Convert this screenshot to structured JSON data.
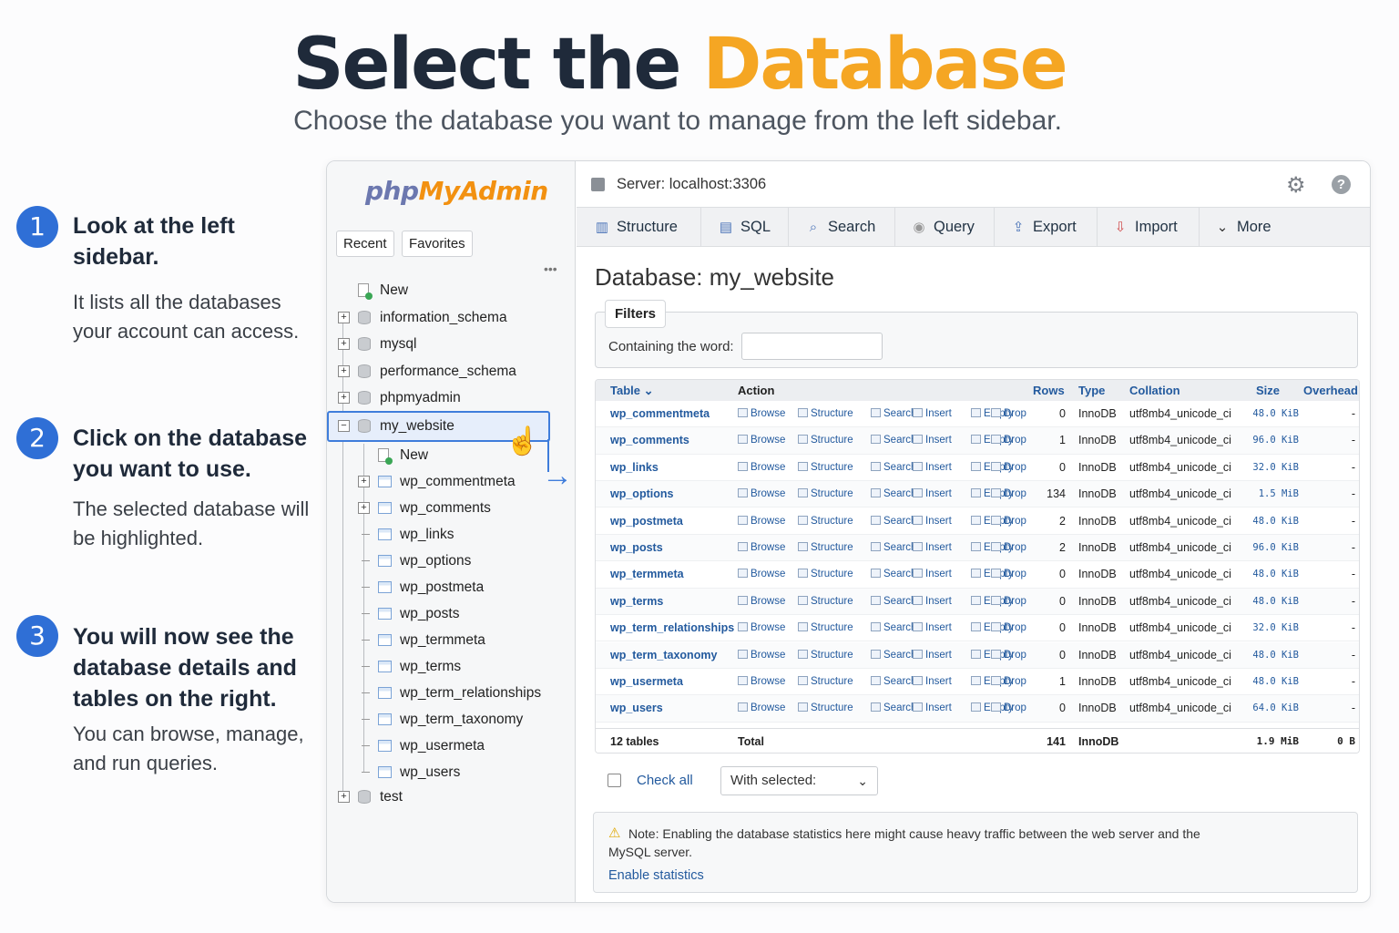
{
  "hero": {
    "title_main": "Select the ",
    "title_accent": "Database",
    "subtitle": "Choose the database you want to manage from the left sidebar.",
    "accent_color": "#f5a623"
  },
  "steps": [
    {
      "num": "1",
      "title": "Look at the left sidebar.",
      "desc": "It lists all the databases your account can access."
    },
    {
      "num": "2",
      "title": "Click on the database you want to use.",
      "desc": "The selected database will be highlighted."
    },
    {
      "num": "3",
      "title": "You will now see the database details and tables on the right.",
      "desc": "You can browse, manage, and run queries."
    }
  ],
  "sidebar": {
    "logo_php": "php",
    "logo_mya": "MyAdmin",
    "recent": "Recent",
    "favorites": "Favorites",
    "dots": "•••",
    "top_new": "New",
    "databases": [
      "information_schema",
      "mysql",
      "performance_schema",
      "phpmyadmin"
    ],
    "selected_db": "my_website",
    "sub_new": "New",
    "tables": [
      "wp_commentmeta",
      "wp_comments",
      "wp_links",
      "wp_options",
      "wp_postmeta",
      "wp_posts",
      "wp_termmeta",
      "wp_terms",
      "wp_term_relationships",
      "wp_term_taxonomy",
      "wp_usermeta",
      "wp_users"
    ],
    "last_db": "test"
  },
  "topbar": {
    "server": "Server: localhost:3306",
    "icons": [
      "server-icon",
      "gear-icon",
      "help-icon"
    ]
  },
  "tabs": [
    "Structure",
    "SQL",
    "Search",
    "Query",
    "Export",
    "Import",
    "More"
  ],
  "main": {
    "db_title": "Database: my_website",
    "filters_legend": "Filters",
    "filters_label": "Containing the word:",
    "filters_value": ""
  },
  "table": {
    "headers": {
      "table": "Table",
      "action": "Action",
      "rows": "Rows",
      "type": "Type",
      "collation": "Collation",
      "size": "Size",
      "overhead": "Overhead"
    },
    "actions": [
      "Browse",
      "Structure",
      "Search",
      "Insert",
      "Empty",
      "Drop"
    ],
    "rows": [
      {
        "name": "wp_commentmeta",
        "rows": "0",
        "type": "InnoDB",
        "collation": "utf8mb4_unicode_ci",
        "size": "48.0 KiB",
        "overhead": "-"
      },
      {
        "name": "wp_comments",
        "rows": "1",
        "type": "InnoDB",
        "collation": "utf8mb4_unicode_ci",
        "size": "96.0 KiB",
        "overhead": "-"
      },
      {
        "name": "wp_links",
        "rows": "0",
        "type": "InnoDB",
        "collation": "utf8mb4_unicode_ci",
        "size": "32.0 KiB",
        "overhead": "-"
      },
      {
        "name": "wp_options",
        "rows": "134",
        "type": "InnoDB",
        "collation": "utf8mb4_unicode_ci",
        "size": "1.5 MiB",
        "overhead": "-"
      },
      {
        "name": "wp_postmeta",
        "rows": "2",
        "type": "InnoDB",
        "collation": "utf8mb4_unicode_ci",
        "size": "48.0 KiB",
        "overhead": "-"
      },
      {
        "name": "wp_posts",
        "rows": "2",
        "type": "InnoDB",
        "collation": "utf8mb4_unicode_ci",
        "size": "96.0 KiB",
        "overhead": "-"
      },
      {
        "name": "wp_termmeta",
        "rows": "0",
        "type": "InnoDB",
        "collation": "utf8mb4_unicode_ci",
        "size": "48.0 KiB",
        "overhead": "-"
      },
      {
        "name": "wp_terms",
        "rows": "0",
        "type": "InnoDB",
        "collation": "utf8mb4_unicode_ci",
        "size": "48.0 KiB",
        "overhead": "-"
      },
      {
        "name": "wp_term_relationships",
        "rows": "0",
        "type": "InnoDB",
        "collation": "utf8mb4_unicode_ci",
        "size": "32.0 KiB",
        "overhead": "-"
      },
      {
        "name": "wp_term_taxonomy",
        "rows": "0",
        "type": "InnoDB",
        "collation": "utf8mb4_unicode_ci",
        "size": "48.0 KiB",
        "overhead": "-"
      },
      {
        "name": "wp_usermeta",
        "rows": "1",
        "type": "InnoDB",
        "collation": "utf8mb4_unicode_ci",
        "size": "48.0 KiB",
        "overhead": "-"
      },
      {
        "name": "wp_users",
        "rows": "0",
        "type": "InnoDB",
        "collation": "utf8mb4_unicode_ci",
        "size": "64.0 KiB",
        "overhead": "-"
      }
    ],
    "footer": {
      "count": "12 tables",
      "label": "Total",
      "rows": "141",
      "type": "InnoDB",
      "size": "1.9 MiB",
      "overhead": "0 B"
    }
  },
  "bulk": {
    "check_all": "Check all",
    "with_selected": "With selected:"
  },
  "note": {
    "text": "Note: Enabling the database statistics here might cause heavy traffic between the web server and the MySQL server.",
    "link": "Enable statistics"
  }
}
